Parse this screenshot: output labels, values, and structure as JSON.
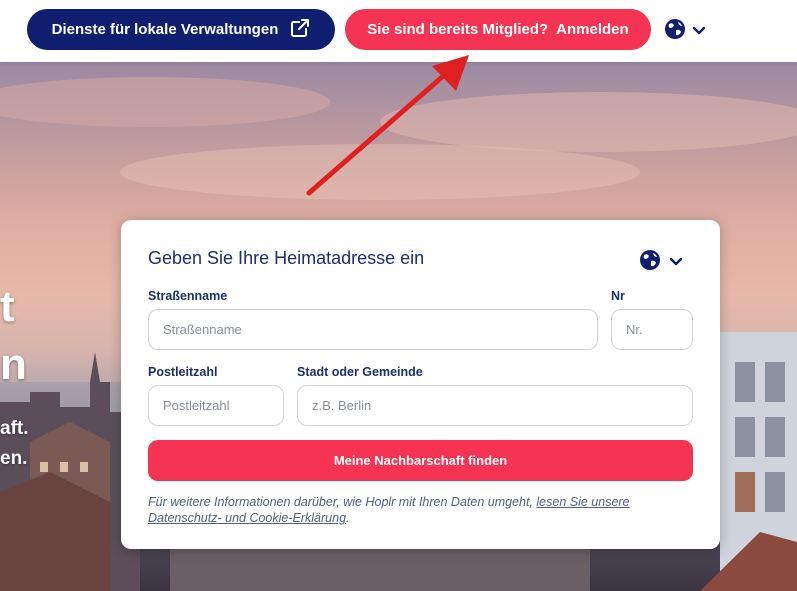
{
  "header": {
    "municipal_button": "Dienste für lokale Verwaltungen",
    "login_question": "Sie sind bereits Mitglied?",
    "login_action": "Anmelden"
  },
  "hero": {
    "line1_fragment": "t",
    "line2_fragment": "n",
    "line3_fragment": "aft.",
    "line4_fragment": "en."
  },
  "form": {
    "title": "Geben Sie Ihre Heimatadresse ein",
    "street_label": "Straßenname",
    "street_placeholder": "Straßenname",
    "number_label": "Nr",
    "number_placeholder": "Nr.",
    "postal_label": "Postleitzahl",
    "postal_placeholder": "Postleitzahl",
    "city_label": "Stadt oder Gemeinde",
    "city_placeholder": "z.B. Berlin",
    "submit_label": "Meine Nachbarschaft finden",
    "note_text": "Für weitere Informationen darüber, wie Hoplr mit Ihren Daten umgeht, ",
    "note_link": "lesen Sie unsere Datenschutz- und Cookie-Erklärung",
    "note_end": "."
  },
  "colors": {
    "navy": "#0f1e6e",
    "accent": "#f43452",
    "title": "#1b2f6d",
    "arrow": "#e02020"
  },
  "icons": {
    "external": "external-link-icon",
    "globe": "globe-icon",
    "chevron": "chevron-down-icon"
  }
}
